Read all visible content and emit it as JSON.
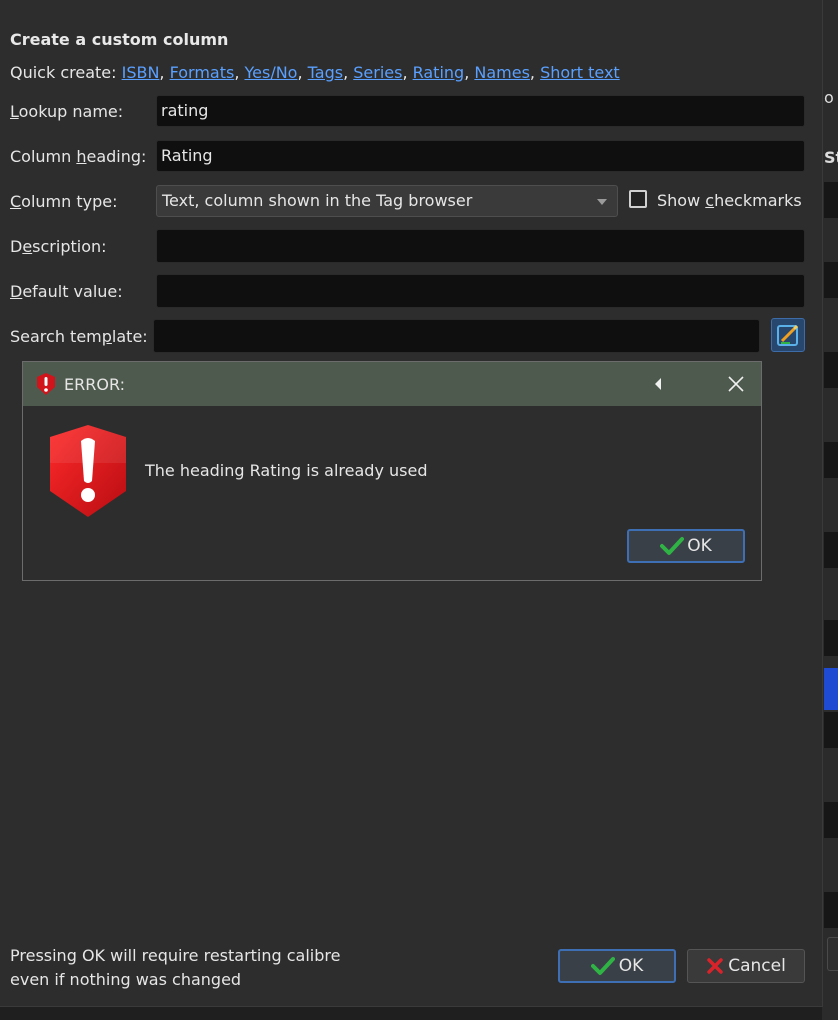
{
  "dialog": {
    "title": "Create a custom column",
    "quick_create_label": "Quick create: ",
    "quick_create_links": [
      "ISBN",
      "Formats",
      "Yes/No",
      "Tags",
      "Series",
      "Rating",
      "Names",
      "Short text"
    ],
    "fields": {
      "lookup_name": {
        "label_pre": "",
        "label_ul": "L",
        "label_post": "ookup name:",
        "value": "rating"
      },
      "column_heading": {
        "label_pre": "Column ",
        "label_ul": "h",
        "label_post": "eading:",
        "value": "Rating"
      },
      "column_type": {
        "label_pre": "",
        "label_ul": "C",
        "label_post": "olumn type:",
        "value": "Text, column shown in the Tag browser"
      },
      "description": {
        "label_pre": "D",
        "label_ul": "e",
        "label_post": "scription:",
        "value": ""
      },
      "default_value": {
        "label_pre": "",
        "label_ul": "D",
        "label_post": "efault value:",
        "value": ""
      },
      "search_template": {
        "label_pre": "Search tem",
        "label_ul": "p",
        "label_post": "late:",
        "value": ""
      }
    },
    "show_checkmarks": {
      "label_pre": "Show ",
      "label_ul": "c",
      "label_post": "heckmarks",
      "checked": false
    },
    "footer_note_line1": "Pressing OK will require restarting calibre",
    "footer_note_line2": "even if nothing was changed",
    "ok_label": "OK",
    "cancel_label": "Cancel"
  },
  "error_popup": {
    "title": "ERROR:",
    "message": "The heading Rating is already used",
    "ok_label": "OK"
  },
  "background": {
    "clip_text_1": "o",
    "clip_text_2": "Sta"
  },
  "colors": {
    "link": "#5aa0ff",
    "error_bar": "#4e5a4d",
    "error_red": "#d1131b",
    "ok_check": "#2fb344",
    "cancel_x": "#d9232a",
    "selected_row": "#1e4bd2"
  },
  "icons": [
    "error-shield-icon",
    "error-shield-large-icon",
    "collapse-triangle-icon",
    "close-icon",
    "check-icon",
    "cross-icon",
    "template-edit-icon"
  ]
}
